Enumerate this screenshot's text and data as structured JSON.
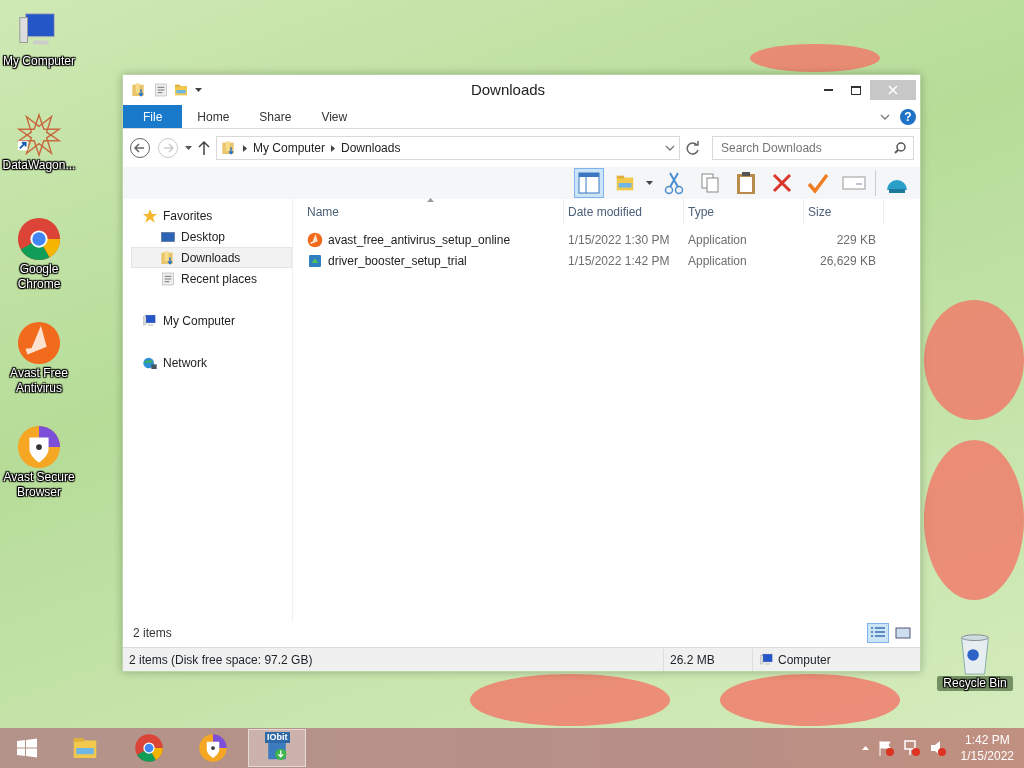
{
  "desktop_icons": [
    {
      "label": "My Computer",
      "kind": "computer"
    },
    {
      "label": "DataWagon...",
      "kind": "star"
    },
    {
      "label": "Google Chrome",
      "kind": "chrome"
    },
    {
      "label": "Avast Free Antivirus",
      "kind": "avast"
    },
    {
      "label": "Avast Secure Browser",
      "kind": "secure"
    },
    {
      "label": "Recycle Bin",
      "kind": "bin"
    }
  ],
  "window": {
    "title": "Downloads",
    "ribbon_tabs": [
      {
        "label": "File",
        "kind": "file"
      },
      {
        "label": "Home",
        "kind": "tab"
      },
      {
        "label": "Share",
        "kind": "tab"
      },
      {
        "label": "View",
        "kind": "tab"
      }
    ],
    "address": {
      "path": [
        "My Computer",
        "Downloads"
      ],
      "search_placeholder": "Search Downloads"
    },
    "preview_pane_on": true,
    "nav": [
      {
        "label": "Favorites",
        "kind": "favorites",
        "children": [
          {
            "label": "Desktop",
            "kind": "desktop",
            "selected": false
          },
          {
            "label": "Downloads",
            "kind": "downloads",
            "selected": true
          },
          {
            "label": "Recent places",
            "kind": "recent",
            "selected": false
          }
        ]
      },
      {
        "label": "My Computer",
        "kind": "computer"
      },
      {
        "label": "Network",
        "kind": "network"
      }
    ],
    "help": "?",
    "columns": [
      "Name",
      "Date modified",
      "Type",
      "Size"
    ],
    "rows": [
      {
        "name": "avast_free_antivirus_setup_online",
        "date": "1/15/2022 1:30 PM",
        "type": "Application",
        "size": "229 KB",
        "kind": "avast"
      },
      {
        "name": "driver_booster_setup_trial",
        "date": "1/15/2022 1:42 PM",
        "type": "Application",
        "size": "26,629 KB",
        "kind": "booster"
      }
    ],
    "item_count": "2 items",
    "views": [
      {
        "kind": "details",
        "selected": true
      },
      {
        "kind": "large",
        "selected": false
      }
    ],
    "status": {
      "summary": "2 items (Disk free space: 97.2 GB)",
      "size": "26.2 MB",
      "location": "Computer"
    }
  },
  "taskbar": {
    "buttons": [
      {
        "kind": "explorer",
        "selected": false
      },
      {
        "kind": "chrome",
        "selected": false
      },
      {
        "kind": "secure",
        "selected": false
      },
      {
        "kind": "iobit",
        "label": "IObit",
        "selected": true
      }
    ],
    "time": "1:42 PM",
    "date": "1/15/2022"
  }
}
